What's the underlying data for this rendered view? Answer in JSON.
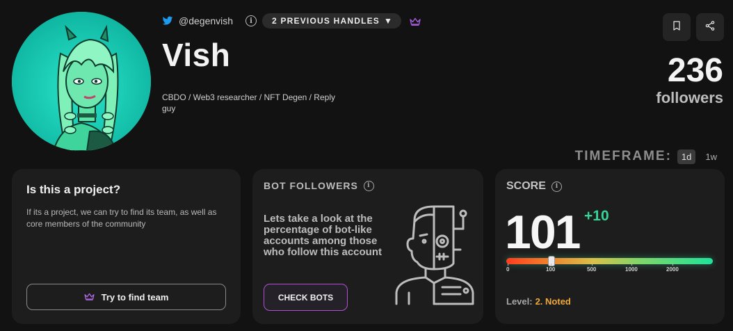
{
  "profile": {
    "handle": "@degenvish",
    "previous_handles_label": "2 PREVIOUS HANDLES",
    "name": "Vish",
    "bio": "CBDO / Web3 researcher / NFT Degen / Reply guy",
    "followers_count": "236",
    "followers_label": "followers"
  },
  "timeframe": {
    "label": "TIMEFRAME:",
    "options": [
      "1d",
      "1w"
    ],
    "selected": "1d"
  },
  "project_card": {
    "title": "Is this a project?",
    "description": "If its a project, we can try to find its team, as well as core members of the community",
    "button_label": "Try to find team"
  },
  "bots_card": {
    "title": "BOT FOLLOWERS",
    "text": "Lets take a look at the percentage of bot-like accounts among those who follow this account",
    "button_label": "CHECK BOTS"
  },
  "score_card": {
    "title": "SCORE",
    "value": "101",
    "delta": "+10",
    "ticks": [
      "0",
      "100",
      "500",
      "1000",
      "2000"
    ],
    "level_label": "Level:",
    "level_value": "2. Noted"
  },
  "colors": {
    "accent_purple": "#b24fd6",
    "score_delta_green": "#35d49a",
    "level_orange": "#f0a93a",
    "twitter_blue": "#1d9bf0"
  },
  "icons": {
    "twitter": "twitter-bird-icon",
    "info": "info-icon",
    "crown": "crown-icon",
    "bookmark": "bookmark-icon",
    "share": "share-icon",
    "robot": "robot-human-icon"
  }
}
